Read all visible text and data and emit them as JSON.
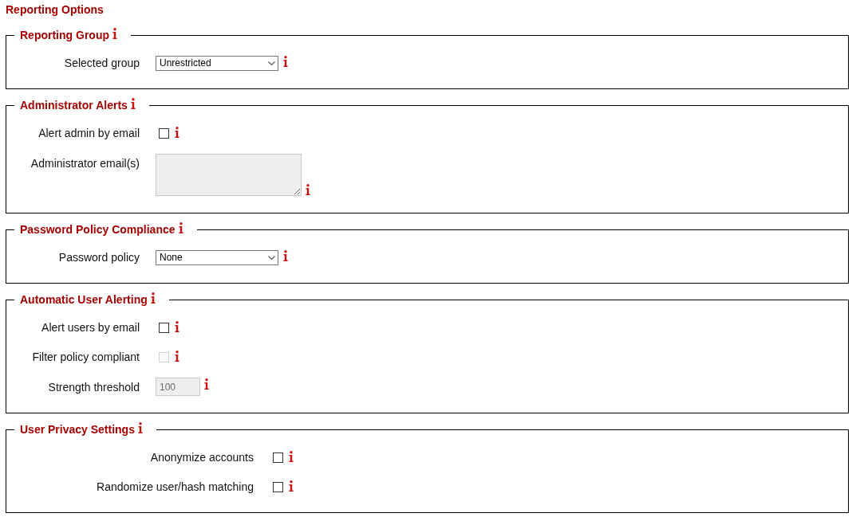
{
  "heading": "Reporting Options",
  "sections": [
    {
      "legend": "Reporting Group",
      "fields": [
        {
          "kind": "select",
          "label": "Selected group",
          "value": "Unrestricted"
        }
      ]
    },
    {
      "legend": "Administrator Alerts",
      "fields": [
        {
          "kind": "checkbox",
          "label": "Alert admin by email",
          "checked": false,
          "disabled": false
        },
        {
          "kind": "textarea",
          "label": "Administrator email(s)",
          "disabled": true
        }
      ]
    },
    {
      "legend": "Password Policy Compliance",
      "fields": [
        {
          "kind": "select",
          "label": "Password policy",
          "value": "None"
        }
      ]
    },
    {
      "legend": "Automatic User Alerting",
      "fields": [
        {
          "kind": "checkbox",
          "label": "Alert users by email",
          "checked": false,
          "disabled": false
        },
        {
          "kind": "checkbox",
          "label": "Filter policy compliant",
          "checked": false,
          "disabled": true
        },
        {
          "kind": "text",
          "label": "Strength threshold",
          "value": "100",
          "disabled": true
        }
      ]
    },
    {
      "legend": "User Privacy Settings",
      "fields": [
        {
          "kind": "checkbox",
          "label": "Anonymize accounts",
          "checked": false,
          "disabled": false
        },
        {
          "kind": "checkbox",
          "label": "Randomize user/hash matching",
          "checked": false,
          "disabled": false
        }
      ]
    }
  ]
}
